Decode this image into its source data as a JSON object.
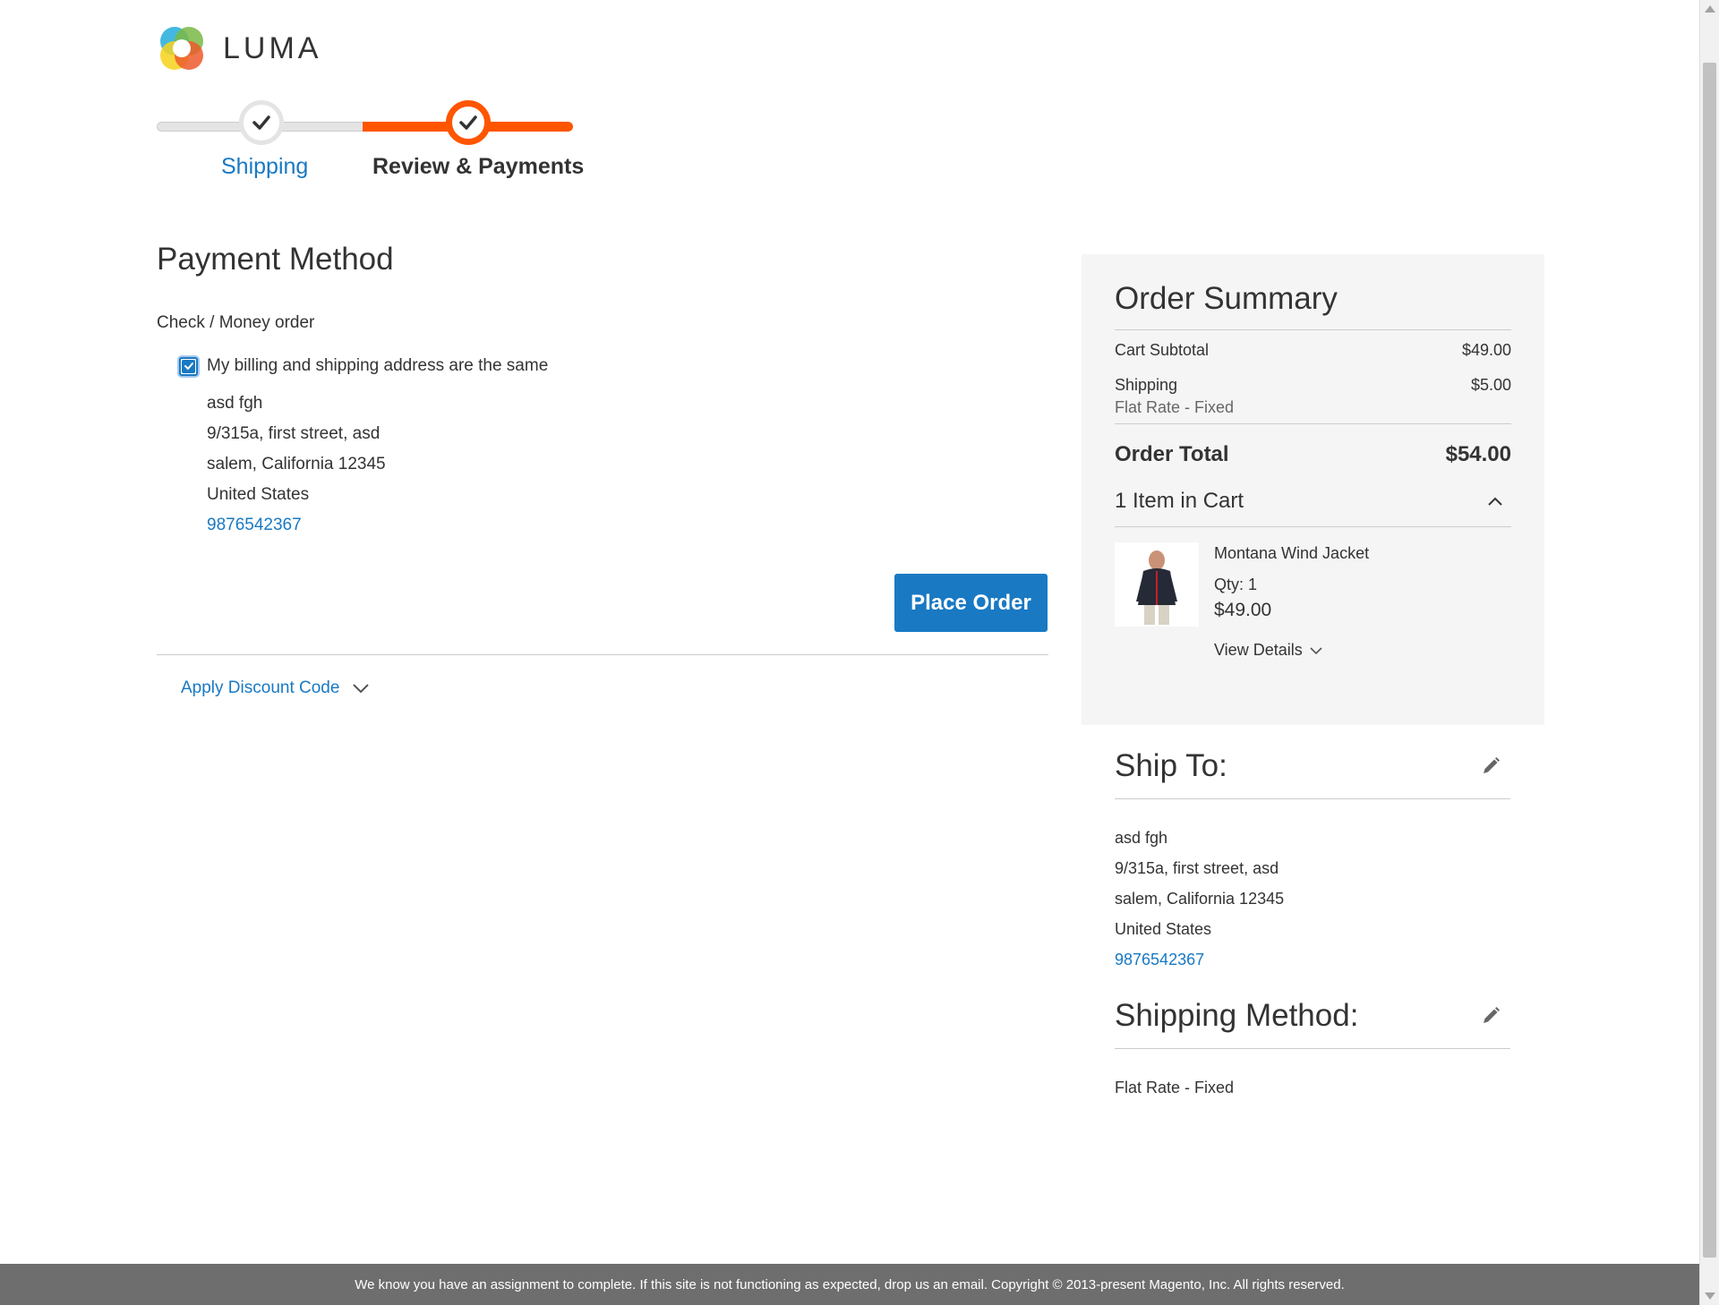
{
  "brand": {
    "name": "LUMA"
  },
  "progress": {
    "steps": [
      {
        "label": "Shipping",
        "status": "complete"
      },
      {
        "label": "Review & Payments",
        "status": "active"
      }
    ]
  },
  "payment": {
    "title": "Payment Method",
    "method_name": "Check / Money order",
    "billing_same_label": "My billing and shipping address are the same",
    "billing_same_checked": true,
    "address": {
      "name": "asd fgh",
      "street": "9/315a, first street, asd",
      "city_line": "salem, California 12345",
      "country": "United States",
      "phone": "9876542367"
    },
    "place_order_label": "Place Order",
    "discount_label": "Apply Discount Code"
  },
  "summary": {
    "title": "Order Summary",
    "subtotal_label": "Cart Subtotal",
    "subtotal_value": "$49.00",
    "shipping_label": "Shipping",
    "shipping_value": "$5.00",
    "shipping_method": "Flat Rate - Fixed",
    "total_label": "Order Total",
    "total_value": "$54.00",
    "items_label": "1 Item in Cart",
    "items": [
      {
        "name": "Montana Wind Jacket",
        "qty_label": "Qty: 1",
        "price": "$49.00",
        "view_details_label": "View Details"
      }
    ]
  },
  "ship_to": {
    "title": "Ship To:",
    "name": "asd fgh",
    "street": "9/315a, first street, asd",
    "city_line": "salem, California 12345",
    "country": "United States",
    "phone": "9876542367"
  },
  "shipping_method": {
    "title": "Shipping Method:",
    "value": "Flat Rate - Fixed"
  },
  "footer": {
    "text": "We know you have an assignment to complete. If this site is not functioning as expected, drop us an email. Copyright © 2013-present Magento, Inc. All rights reserved."
  },
  "colors": {
    "accent_blue": "#1979c3",
    "progress_orange": "#ff5501",
    "summary_bg": "#f5f5f5",
    "footer_bg": "#6e6e6e"
  },
  "icons": {
    "logo": "luma-logo-icon",
    "step_check": "check-icon",
    "discount_toggle": "chevron-down-icon",
    "cart_toggle": "chevron-up-icon",
    "view_details_toggle": "chevron-down-icon",
    "edit": "pencil-icon"
  }
}
